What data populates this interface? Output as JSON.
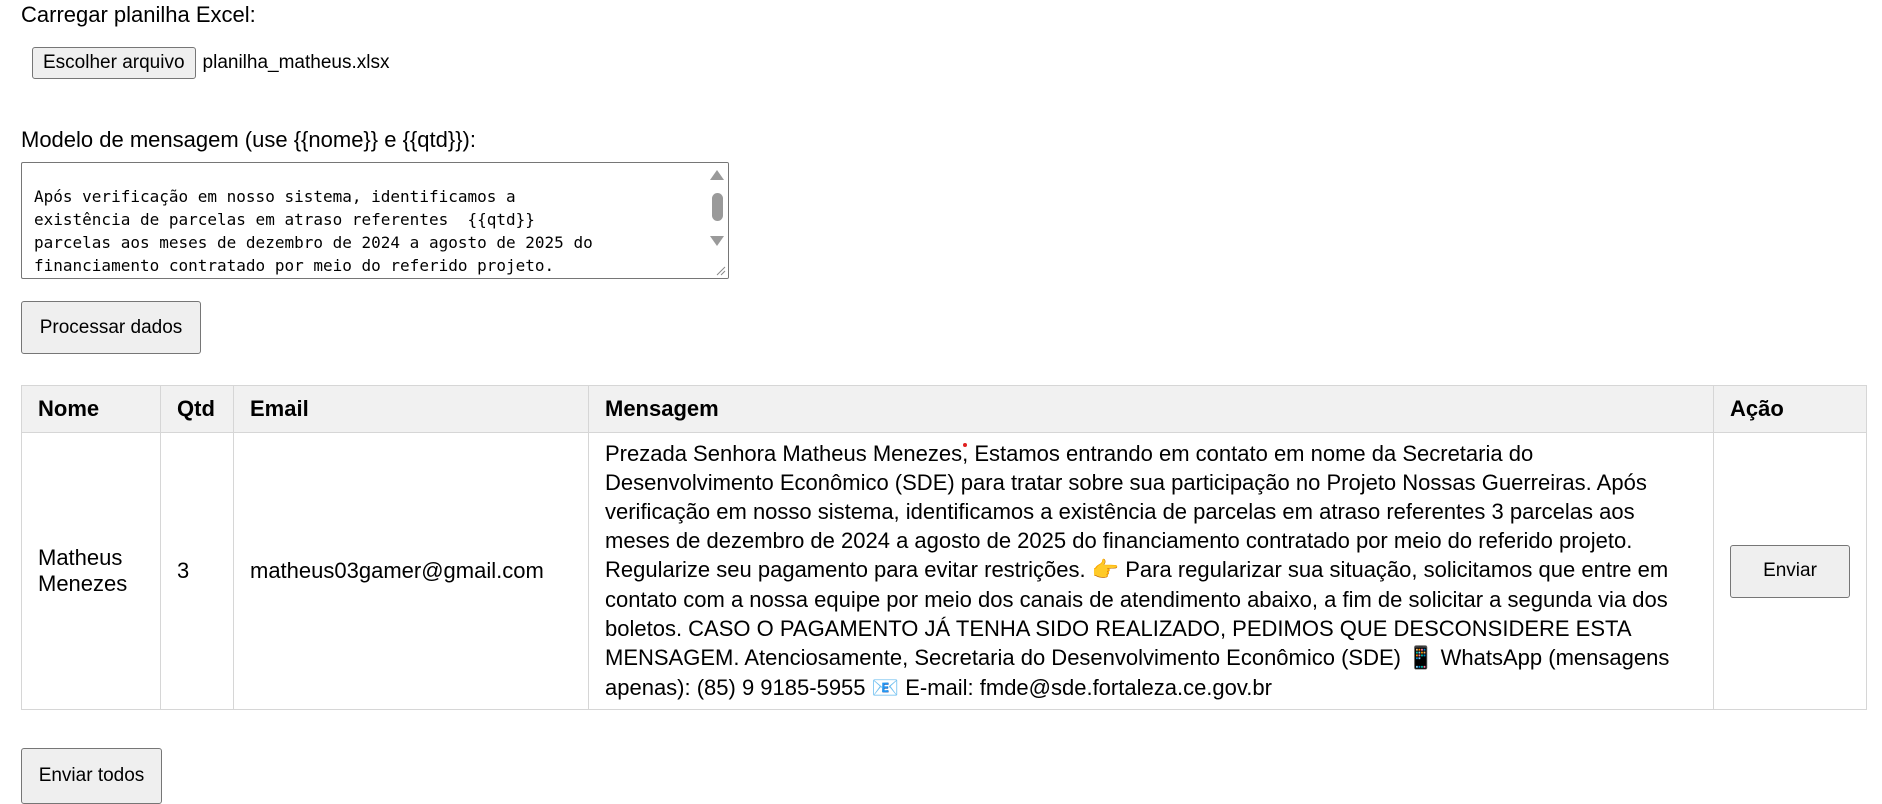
{
  "upload": {
    "label": "Carregar planilha Excel:",
    "button_label": "Escolher arquivo",
    "file_name": "planilha_matheus.xlsx"
  },
  "template": {
    "label": "Modelo de mensagem (use {{nome}} e {{qtd}}):",
    "text": "Após verificação em nosso sistema, identificamos a\nexistência de parcelas em atraso referentes  {{qtd}}\nparcelas aos meses de dezembro de 2024 a agosto de 2025 do\nfinanciamento contratado por meio do referido projeto."
  },
  "process_button": "Processar dados",
  "table": {
    "headers": [
      "Nome",
      "Qtd",
      "Email",
      "Mensagem",
      "Ação"
    ],
    "rows": [
      {
        "nome": "Matheus Menezes",
        "qtd": "3",
        "email": "matheus03gamer@gmail.com",
        "mensagem_part1": "Prezada Senhora Matheus Menezes, Estamos entrando em contato em nome da Secretaria do Desenvolvimento Econômico (SDE) para tratar sobre sua participação no Projeto Nossas Guerreiras. Após verificação em nosso sistema, identificamos a existência de parcelas em atraso referentes 3 parcelas aos meses de dezembro de 2024 a agosto de 2025 do financiamento contratado por meio do referido projeto. Regularize seu pagamento para evitar restrições.",
        "mensagem_part2": "Para regularizar sua situação, solicitamos que entre em contato com a nossa equipe por meio dos canais de atendimento abaixo, a fim de solicitar a segunda via dos boletos. CASO O PAGAMENTO JÁ TENHA SIDO REALIZADO, PEDIMOS QUE DESCONSIDERE ESTA MENSAGEM. Atenciosamente, Secretaria do Desenvolvimento Econômico (SDE)",
        "mensagem_part3": "WhatsApp (mensagens apenas): (85) 9 9185-5955",
        "mensagem_part4": "E-mail: fmde@sde.fortaleza.ce.gov.br",
        "action_label": "Enviar"
      }
    ]
  },
  "send_all_button": "Enviar todos",
  "icons": {
    "pointing": "pointing-hand-icon",
    "phone": "mobile-phone-icon",
    "email": "email-icon"
  }
}
